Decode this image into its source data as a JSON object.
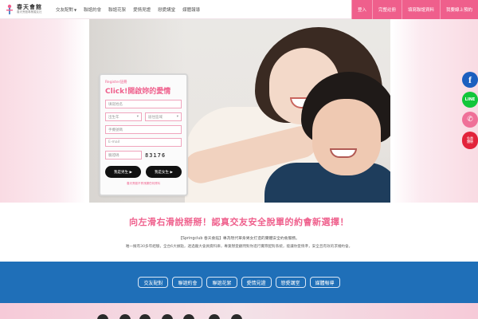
{
  "brand": {
    "name": "春天會館",
    "tagline": "春天會館專業婚友社"
  },
  "nav": {
    "items": [
      {
        "label": "交友配對",
        "has_dropdown": true
      },
      {
        "label": "聯誼約會"
      },
      {
        "label": "聯誼花絮"
      },
      {
        "label": "愛情見證"
      },
      {
        "label": "戀愛講堂"
      },
      {
        "label": "媒體報導"
      }
    ]
  },
  "header_buttons": [
    "登入",
    "完整註冊",
    "填寫聯誼資料",
    "我要線上預約"
  ],
  "form": {
    "kicker": "Register註冊",
    "title": "Click!開啟妳的愛情",
    "name_placeholder": "填寫姓名",
    "year_label": "出生年",
    "location_label": "居住區域",
    "phone_placeholder": "手機號碼",
    "email_placeholder": "E-mail",
    "captcha_placeholder": "驗證碼",
    "captcha_code": "83176",
    "male_button": "我是男生 ▶",
    "female_button": "我是女生 ▶",
    "note": "春天會館不會洩漏任何資料"
  },
  "side_icons": {
    "facebook": "f",
    "line": "LINE",
    "phone": "✆",
    "more": "免費\n體驗"
  },
  "slogan": "向左滑右滑說掰掰！認真交友安全脫單的約會新選擇！",
  "intro": {
    "line1": "【Springclub 春天會館】專為現代單身男女打造的實體安全約會服務。",
    "line2": "唯一擁有30多年經驗，全台6大據點，透過龐大會員資料庫，專業戀愛顧問對你進行實際配對系統，能讓你愛情準，安全且有效的求婚約會。"
  },
  "bluebar": [
    "交友配對",
    "聯誼約會",
    "聯誼花絮",
    "愛情見證",
    "戀愛講堂",
    "媒體報導"
  ],
  "colors": {
    "accent": "#ef5f8c",
    "blue": "#1f6fb8",
    "facebook": "#1c5fbf",
    "line": "#13c63a"
  }
}
